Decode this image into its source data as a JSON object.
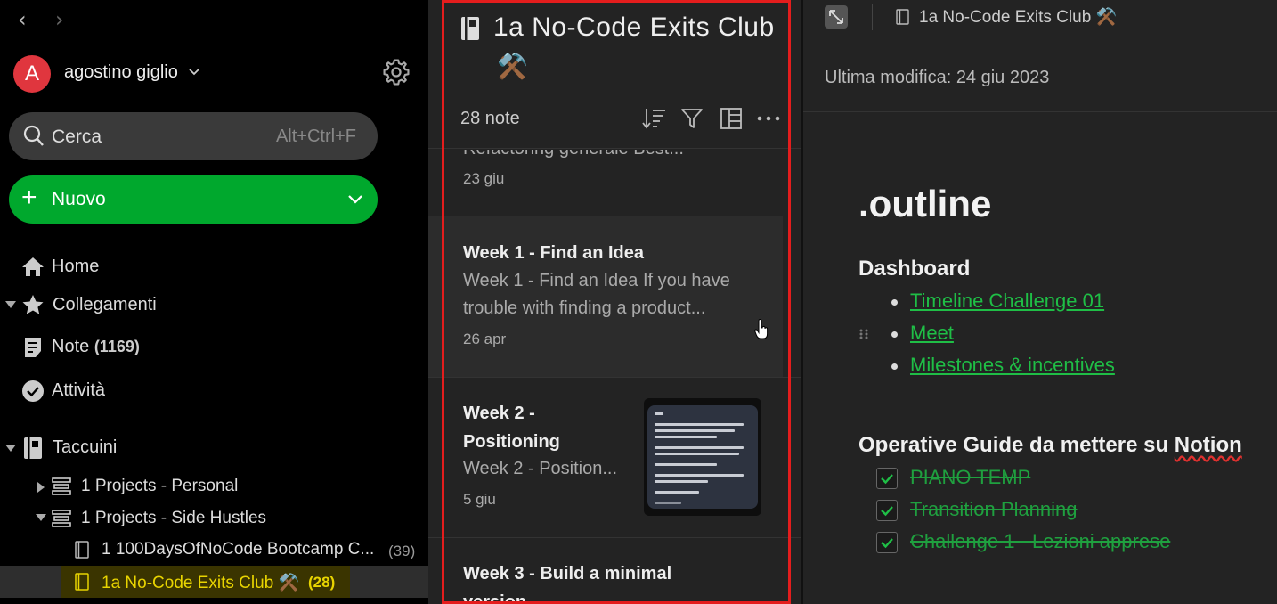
{
  "sidebar": {
    "user": {
      "initial": "A",
      "name": "agostino giglio"
    },
    "search": {
      "label": "Cerca",
      "shortcut": "Alt+Ctrl+F"
    },
    "new_button": {
      "label": "Nuovo"
    },
    "nav": {
      "home": "Home",
      "shortcuts": "Collegamenti",
      "notes": "Note",
      "notes_count": "(1169)",
      "tasks": "Attività",
      "notebooks": "Taccuini"
    },
    "notebooks": [
      {
        "label": "1 Projects - Personal"
      },
      {
        "label": "1 Projects - Side Hustles"
      },
      {
        "label": "1 100DaysOfNoCode Bootcamp C...",
        "count": "(39)"
      },
      {
        "label": "1a No-Code Exits Club ⚒️",
        "count": "(28)"
      }
    ]
  },
  "note_list": {
    "title": "1a No-Code Exits Club",
    "title_emoji": "⚒️",
    "count": "28 note",
    "cards": [
      {
        "snippet": "Refactoring generale Best...",
        "date": "23 giu"
      },
      {
        "title": "Week 1 - Find an Idea",
        "snippet_line1": "Week 1 - Find an Idea If you have",
        "snippet_line2": "trouble with finding a product...",
        "date": "26 apr"
      },
      {
        "title_line1": "Week 2 -",
        "title_line2": "Positioning",
        "snippet": "Week 2 - Position...",
        "date": "5 giu"
      },
      {
        "title_line1": "Week 3 - Build a minimal",
        "title_line2": "version"
      }
    ]
  },
  "editor": {
    "breadcrumb": "1a No-Code Exits Club ⚒️",
    "last_modified": "Ultima modifica: 24 giu 2023",
    "heading": ".outline",
    "section1": {
      "title": "Dashboard",
      "links": [
        "Timeline Challenge 01",
        "Meet",
        "Milestones & incentives"
      ]
    },
    "section2": {
      "title_prefix": "Operative Guide da mettere su ",
      "title_word": "Notion",
      "tasks": [
        "PIANO TEMP",
        "Transition Planning",
        "Challenge 1 - Lezioni apprese"
      ]
    }
  },
  "colors": {
    "accent_green": "#00a82d",
    "link_green": "#1fbe46",
    "avatar_red": "#e0363e",
    "highlight_border": "#e41d1d",
    "active_text": "#e8d400"
  }
}
